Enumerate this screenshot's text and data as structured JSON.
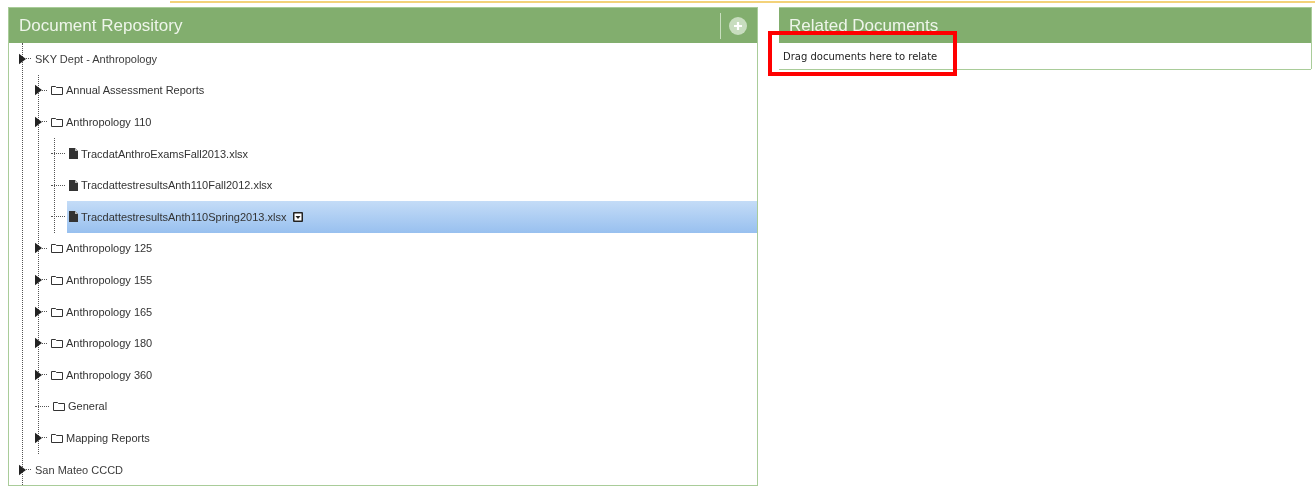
{
  "repository": {
    "title": "Document Repository",
    "tree": [
      {
        "kind": "root",
        "label": "SKY Dept - Anthropology",
        "expandable": true,
        "selected": false,
        "children": [
          {
            "kind": "folder",
            "label": "Annual Assessment Reports",
            "expandable": true,
            "selected": false
          },
          {
            "kind": "folder",
            "label": "Anthropology 110",
            "expandable": true,
            "selected": false,
            "children": [
              {
                "kind": "file",
                "label": "TracdatAnthroExamsFall2013.xlsx",
                "expandable": false,
                "selected": false
              },
              {
                "kind": "file",
                "label": "TracdattestresultsAnth110Fall2012.xlsx",
                "expandable": false,
                "selected": false
              },
              {
                "kind": "file",
                "label": "TracdattestresultsAnth110Spring2013.xlsx",
                "expandable": false,
                "selected": true
              }
            ]
          },
          {
            "kind": "folder",
            "label": "Anthropology 125",
            "expandable": true,
            "selected": false
          },
          {
            "kind": "folder",
            "label": "Anthropology 155",
            "expandable": true,
            "selected": false
          },
          {
            "kind": "folder",
            "label": "Anthropology 165",
            "expandable": true,
            "selected": false
          },
          {
            "kind": "folder",
            "label": "Anthropology 180",
            "expandable": true,
            "selected": false
          },
          {
            "kind": "folder",
            "label": "Anthropology 360",
            "expandable": true,
            "selected": false
          },
          {
            "kind": "folder",
            "label": "General",
            "expandable": false,
            "selected": false
          },
          {
            "kind": "folder",
            "label": "Mapping Reports",
            "expandable": true,
            "selected": false
          }
        ]
      },
      {
        "kind": "root",
        "label": "San Mateo CCCD",
        "expandable": true,
        "selected": false
      }
    ]
  },
  "related_documents": {
    "title": "Related Documents",
    "drop_zone": {
      "text": "Drag documents here to relate",
      "highlighted": true
    }
  }
}
